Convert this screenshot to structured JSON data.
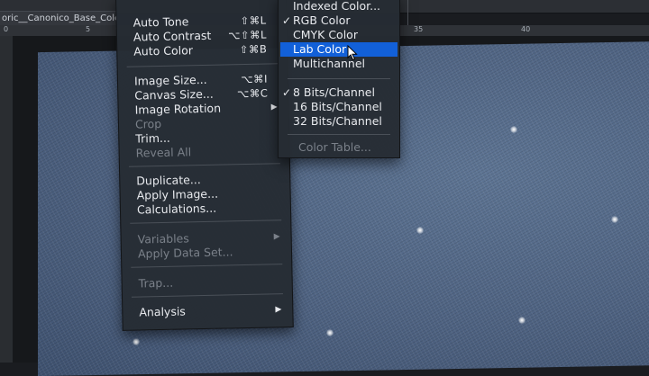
{
  "document": {
    "tab_title": "oric__Canonico_Base_Colo"
  },
  "ruler": {
    "top_ticks": [
      "0",
      "5",
      "35",
      "40"
    ]
  },
  "image_menu": {
    "items": [
      {
        "label": "Auto Tone",
        "shortcut": "⇧⌘L",
        "enabled": true
      },
      {
        "label": "Auto Contrast",
        "shortcut": "⌥⇧⌘L",
        "enabled": true
      },
      {
        "label": "Auto Color",
        "shortcut": "⇧⌘B",
        "enabled": true
      },
      {
        "label": "Image Size...",
        "shortcut": "⌥⌘I",
        "enabled": true
      },
      {
        "label": "Canvas Size...",
        "shortcut": "⌥⌘C",
        "enabled": true
      },
      {
        "label": "Image Rotation",
        "shortcut": "",
        "enabled": true,
        "submenu": true
      },
      {
        "label": "Crop",
        "shortcut": "",
        "enabled": false
      },
      {
        "label": "Trim...",
        "shortcut": "",
        "enabled": true
      },
      {
        "label": "Reveal All",
        "shortcut": "",
        "enabled": false
      },
      {
        "label": "Duplicate...",
        "shortcut": "",
        "enabled": true
      },
      {
        "label": "Apply Image...",
        "shortcut": "",
        "enabled": true
      },
      {
        "label": "Calculations...",
        "shortcut": "",
        "enabled": true
      },
      {
        "label": "Variables",
        "shortcut": "",
        "enabled": false,
        "submenu": true
      },
      {
        "label": "Apply Data Set...",
        "shortcut": "",
        "enabled": false
      },
      {
        "label": "Trap...",
        "shortcut": "",
        "enabled": false
      },
      {
        "label": "Analysis",
        "shortcut": "",
        "enabled": true,
        "submenu": true
      }
    ]
  },
  "mode_submenu": {
    "items": [
      {
        "label": "Indexed Color...",
        "checked": false,
        "highlighted": false,
        "enabled": true
      },
      {
        "label": "RGB Color",
        "checked": true,
        "highlighted": false,
        "enabled": true
      },
      {
        "label": "CMYK Color",
        "checked": false,
        "highlighted": false,
        "enabled": true
      },
      {
        "label": "Lab Color",
        "checked": false,
        "highlighted": true,
        "enabled": true
      },
      {
        "label": "Multichannel",
        "checked": false,
        "highlighted": false,
        "enabled": true
      },
      {
        "label": "8 Bits/Channel",
        "checked": true,
        "highlighted": false,
        "enabled": true
      },
      {
        "label": "16 Bits/Channel",
        "checked": false,
        "highlighted": false,
        "enabled": true
      },
      {
        "label": "32 Bits/Channel",
        "checked": false,
        "highlighted": false,
        "enabled": true
      },
      {
        "label": "Color Table...",
        "checked": false,
        "highlighted": false,
        "enabled": false
      }
    ],
    "checkmark": "✓"
  },
  "glyphs": {
    "submenu_arrow": "▶"
  },
  "colors": {
    "highlight": "#1260d8",
    "menu_bg": "#262c34",
    "denim": "#56698a"
  }
}
